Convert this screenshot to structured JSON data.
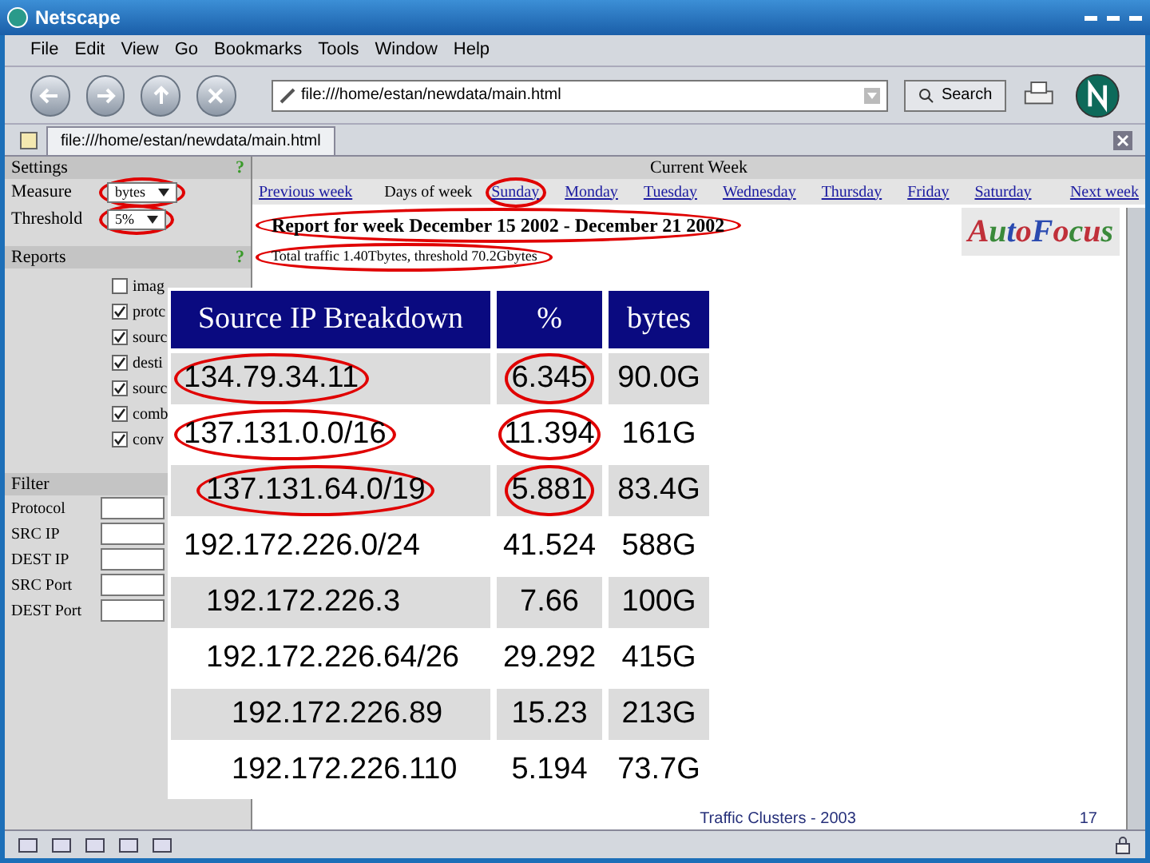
{
  "window": {
    "title": "Netscape"
  },
  "menu": [
    "File",
    "Edit",
    "View",
    "Go",
    "Bookmarks",
    "Tools",
    "Window",
    "Help"
  ],
  "toolbar": {
    "url": "file:///home/estan/newdata/main.html",
    "search": "Search"
  },
  "tabs": [
    {
      "label": "file:///home/estan/newdata/main.html",
      "selected": true
    }
  ],
  "sidebar": {
    "settings": {
      "title": "Settings",
      "help": "?",
      "fields": [
        {
          "label": "Measure",
          "value": "bytes",
          "circled": true
        },
        {
          "label": "Threshold",
          "value": "5%",
          "circled": true
        }
      ]
    },
    "reports": {
      "title": "Reports",
      "help": "?",
      "items": [
        {
          "label": "imag",
          "checked": false
        },
        {
          "label": "protc",
          "checked": true
        },
        {
          "label": "sourc",
          "checked": true
        },
        {
          "label": "desti",
          "checked": true
        },
        {
          "label": "sourc",
          "checked": true
        },
        {
          "label": "comb",
          "checked": true
        },
        {
          "label": "conv",
          "checked": true
        }
      ]
    },
    "filter": {
      "title": "Filter",
      "fields": [
        "Protocol",
        "SRC IP",
        "DEST IP",
        "SRC Port",
        "DEST Port"
      ]
    }
  },
  "main": {
    "header": "Current Week",
    "previous": "Previous week",
    "days_label": "Days of week",
    "days": [
      {
        "label": "Sunday",
        "circled": true
      },
      {
        "label": "Monday",
        "circled": false
      },
      {
        "label": "Tuesday",
        "circled": false
      },
      {
        "label": "Wednesday",
        "circled": false
      },
      {
        "label": "Thursday",
        "circled": false
      },
      {
        "label": "Friday",
        "circled": false
      },
      {
        "label": "Saturday",
        "circled": false
      }
    ],
    "next": "Next week",
    "report_title": "Report for week December 15 2002 - December 21 2002",
    "report_subtitle": "Total traffic 1.40Tbytes, threshold 70.2Gbytes",
    "logo": "AutoFocus"
  },
  "breakdown": {
    "columns": [
      "Source IP Breakdown",
      "%",
      "bytes"
    ],
    "rows": [
      {
        "ip": "134.79.34.11",
        "percent": "6.345",
        "bytes": "90.0G",
        "circled": true
      },
      {
        "ip": "137.131.0.0/16",
        "percent": "11.394",
        "bytes": "161G",
        "circled": true,
        "children": [
          {
            "ip": "137.131.64.0/19",
            "percent": "5.881",
            "bytes": "83.4G",
            "circled": true
          }
        ]
      },
      {
        "ip": "192.172.226.0/24",
        "percent": "41.524",
        "bytes": "588G",
        "circled": false,
        "children": [
          {
            "ip": "192.172.226.3",
            "percent": "7.66",
            "bytes": "100G",
            "circled": false
          },
          {
            "ip": "192.172.226.64/26",
            "percent": "29.292",
            "bytes": "415G",
            "circled": false,
            "children": [
              {
                "ip": "192.172.226.89",
                "percent": "15.23",
                "bytes": "213G",
                "circled": false
              },
              {
                "ip": "192.172.226.110",
                "percent": "5.194",
                "bytes": "73.7G",
                "circled": false
              }
            ]
          }
        ]
      }
    ]
  },
  "footer": {
    "title": "Traffic Clusters - 2003",
    "page": "17"
  }
}
